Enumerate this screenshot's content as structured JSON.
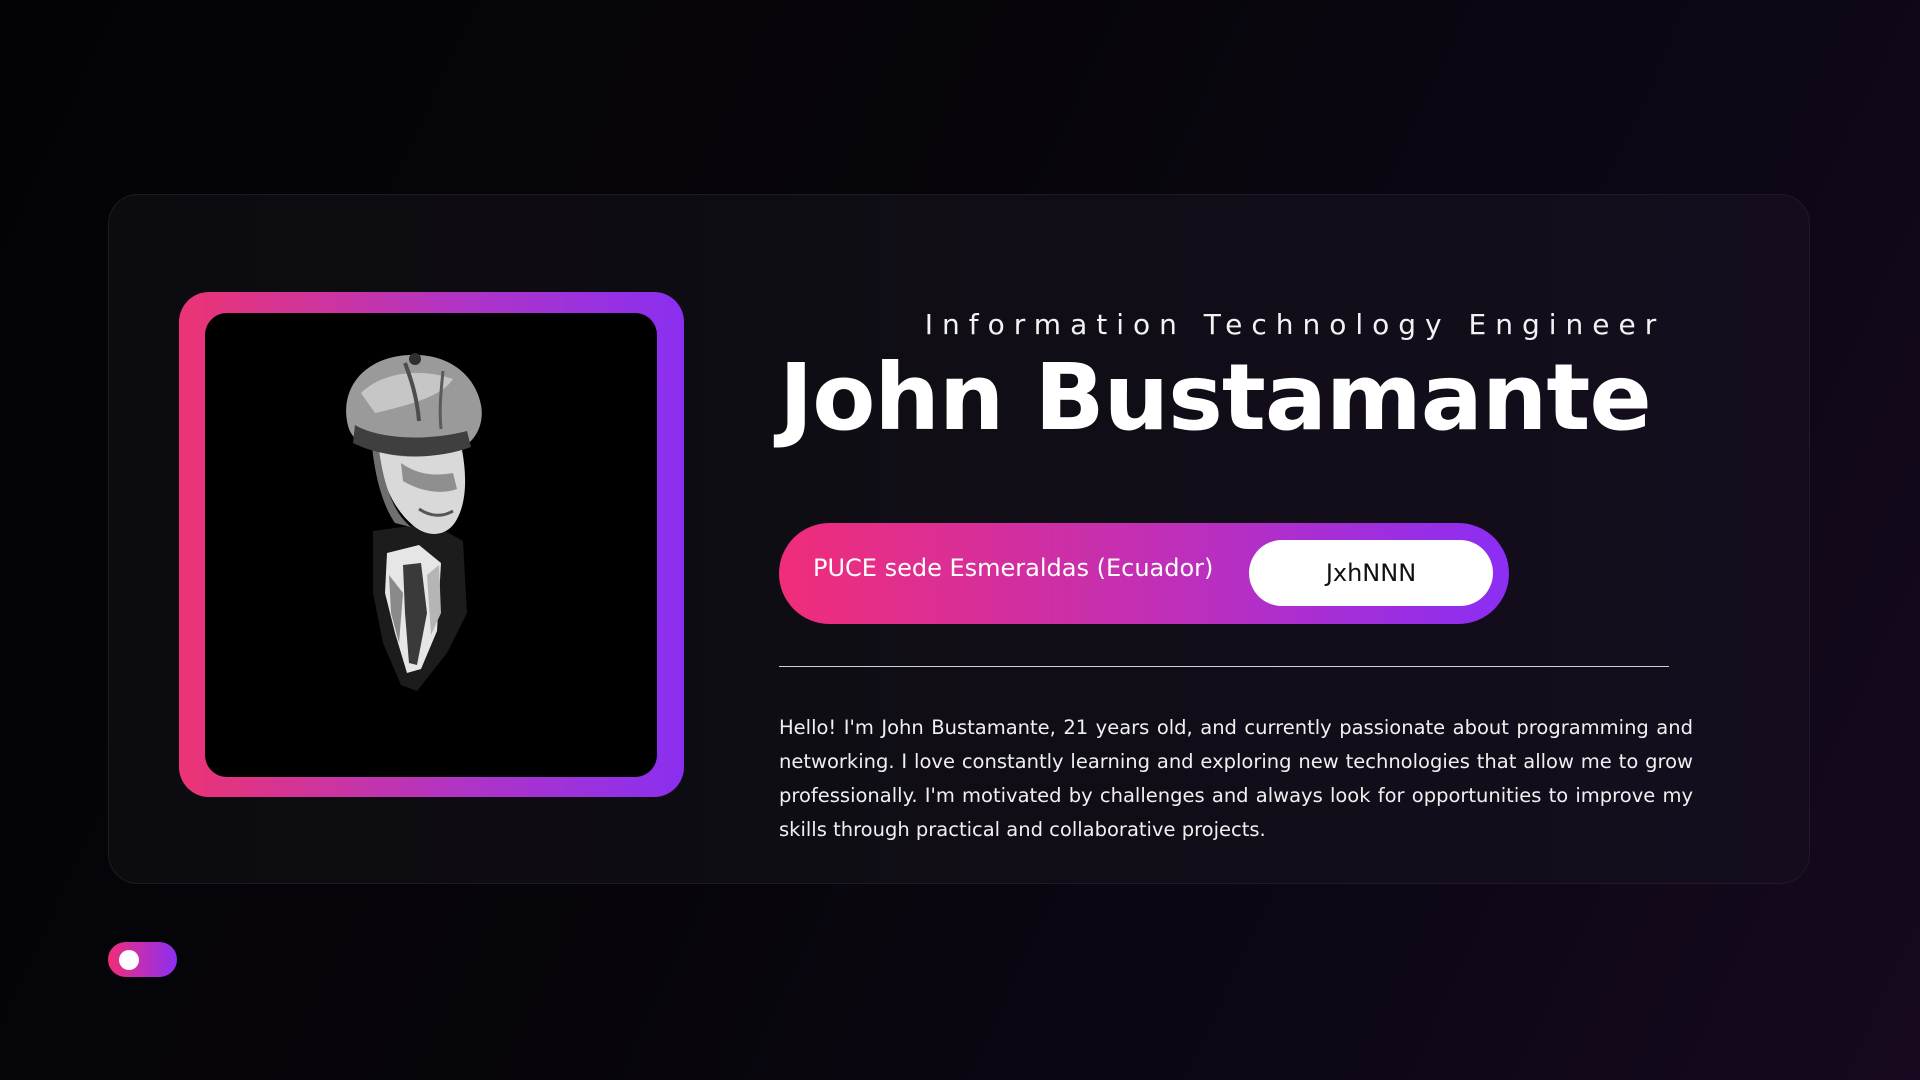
{
  "profile": {
    "subtitle": "Information Technology Engineer",
    "name": "John Bustamante",
    "institution": "PUCE sede Esmeraldas (Ecuador)",
    "handle_button": "JxhNNN",
    "bio": "Hello! I'm John Bustamante, 21 years old, and currently passionate about programming and networking. I love constantly learning and exploring new technologies that allow me to grow professionally. I'm motivated by challenges and always look for opportunities to improve my skills through practical and collaborative projects.",
    "photo_icon": "profile-portrait-image"
  },
  "theme": {
    "accent_start": "#f02d79",
    "accent_end": "#8b2ef4",
    "background": "#07050b",
    "toggle_state": "off"
  }
}
